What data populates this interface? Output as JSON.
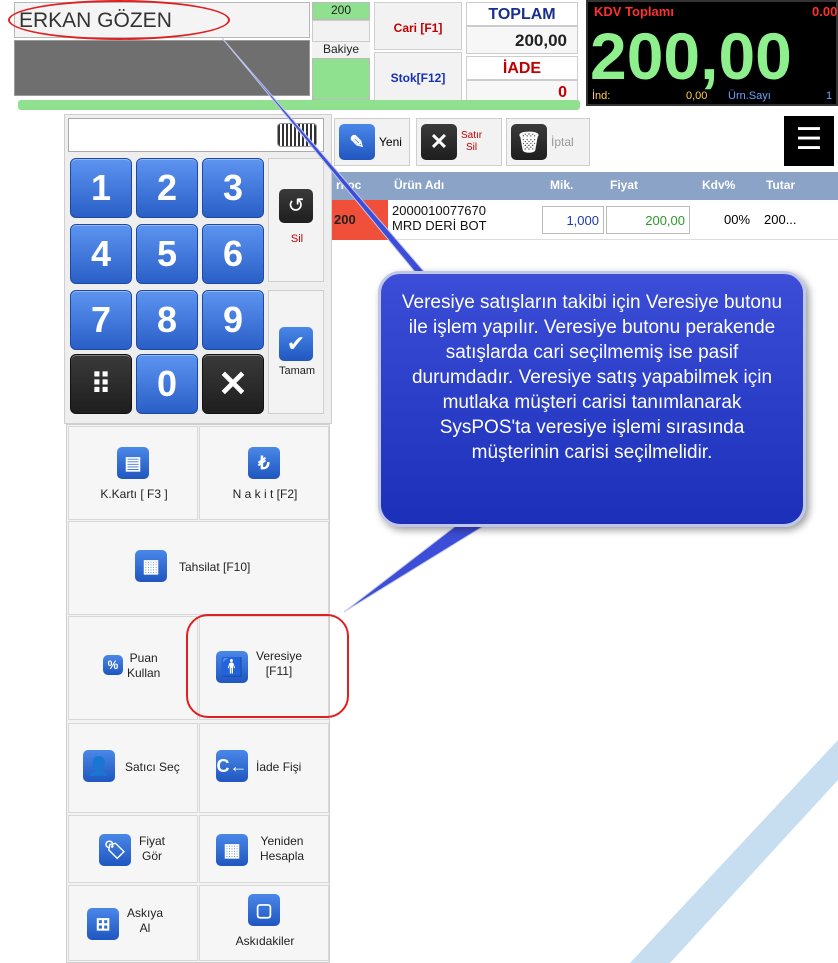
{
  "header": {
    "customer_name": "ERKAN GÖZEN",
    "top_value": "200",
    "bakiye_label": "Bakiye",
    "cari_button": "Cari [F1]",
    "stok_button": "Stok[F12]",
    "toplam_label": "TOPLAM",
    "toplam_value": "200,00",
    "iade_label": "İADE",
    "iade_value": "0"
  },
  "kdv_panel": {
    "label": "KDV Toplamı",
    "value": "0.00",
    "big_total": "200,00",
    "ind_label": "İnd:",
    "ind_value": "0,00",
    "urn_label": "Ürn.Sayı",
    "urn_value": "1"
  },
  "keypad": {
    "keys": [
      "1",
      "2",
      "3",
      "4",
      "5",
      "6",
      "7",
      "8",
      "9",
      "0"
    ],
    "sil_label": "Sil",
    "tamam_label": "Tamam"
  },
  "functions": {
    "kkarti": "K.Kartı [ F3 ]",
    "nakit": "N a k i t [F2]",
    "tahsilat": "Tahsilat [F10]",
    "puan_line1": "Puan",
    "puan_line2": "Kullan",
    "veresiye_line1": "Veresiye",
    "veresiye_line2": "[F11]",
    "satici": "Satıcı Seç",
    "iade_fisi": "İade Fişi",
    "fiyat_line1": "Fiyat",
    "fiyat_line2": "Gör",
    "yeniden_line1": "Yeniden",
    "yeniden_line2": "Hesapla",
    "askiya_line1": "Askıya",
    "askiya_line2": "Al",
    "askidakiler": "Askıdakiler"
  },
  "toolbar": {
    "yeni": "Yeni",
    "satir_sil_line1": "Satır",
    "satir_sil_line2": "Sil",
    "iptal": "İptal"
  },
  "table": {
    "headers": [
      "rkoc",
      "Ürün Adı",
      "Mik.",
      "Fiyat",
      "Kdv%",
      "Tutar"
    ],
    "row": {
      "barkod": "200",
      "urun_line1": "2000010077670",
      "urun_line2": "MRD DERİ BOT",
      "miktar": "1,000",
      "fiyat": "200,00",
      "kdv": "00%",
      "tutar": "200..."
    }
  },
  "callout_text": "Veresiye satışların takibi için Veresiye butonu ile işlem yapılır. Veresiye butonu perakende satışlarda cari seçilmemiş ise pasif durumdadır. Veresiye satış yapabilmek için mutlaka müşteri carisi tanımlanarak SysPOS'ta veresiye işlemi sırasında müşterinin carisi seçilmelidir.",
  "colors": {
    "accent_blue": "#2a5fc7",
    "callout_blue": "#2a3cc8",
    "annotation_red": "#e02020",
    "big_total_green": "#8df08d",
    "table_header": "#8aa3c7"
  }
}
